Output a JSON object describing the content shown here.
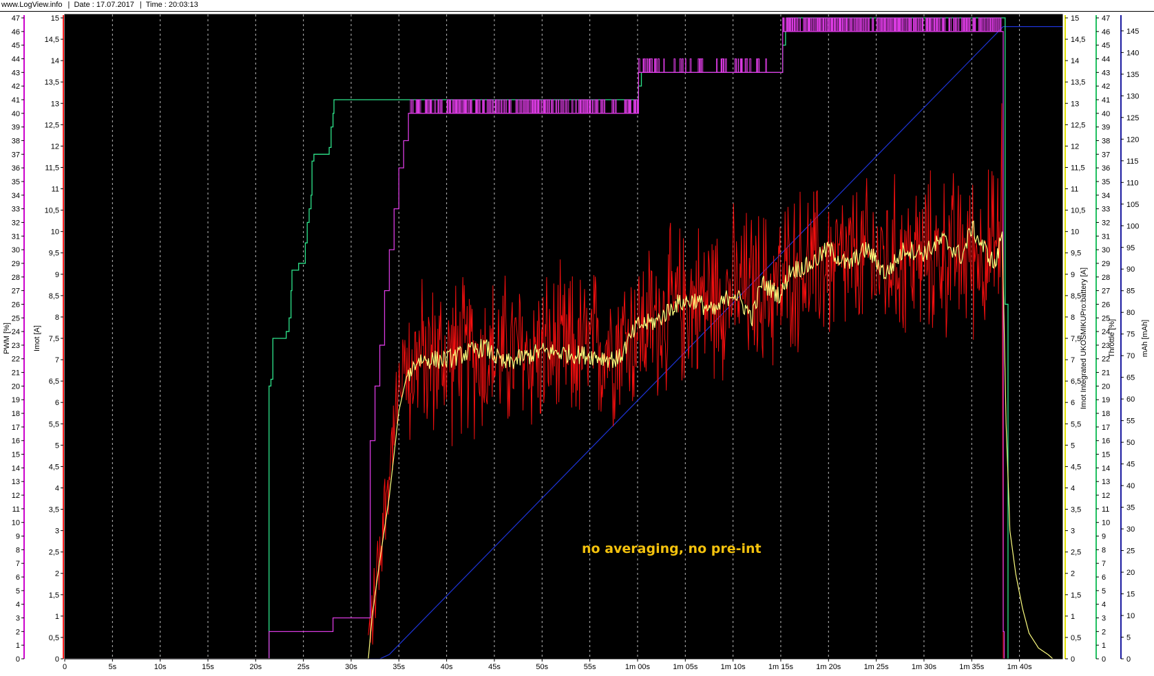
{
  "header": {
    "site": "www.LogView.info",
    "date": "Date : 17.07.2017",
    "time": "Time : 20:03:13"
  },
  "chart_data": {
    "type": "line",
    "annotation": "no averaging, no pre-int",
    "background": "#000000",
    "grid": "vertical dashed",
    "x_axis": {
      "unit": "s",
      "range": [
        0,
        104.5
      ],
      "ticks": [
        {
          "v": 0,
          "label": "0"
        },
        {
          "v": 5,
          "label": "5s"
        },
        {
          "v": 10,
          "label": "10s"
        },
        {
          "v": 15,
          "label": "15s"
        },
        {
          "v": 20,
          "label": "20s"
        },
        {
          "v": 25,
          "label": "25s"
        },
        {
          "v": 30,
          "label": "30s"
        },
        {
          "v": 35,
          "label": "35s"
        },
        {
          "v": 40,
          "label": "40s"
        },
        {
          "v": 45,
          "label": "45s"
        },
        {
          "v": 50,
          "label": "50s"
        },
        {
          "v": 55,
          "label": "55s"
        },
        {
          "v": 60,
          "label": "1m 00s"
        },
        {
          "v": 65,
          "label": "1m 05s"
        },
        {
          "v": 70,
          "label": "1m 10s"
        },
        {
          "v": 75,
          "label": "1m 15s"
        },
        {
          "v": 80,
          "label": "1m 20s"
        },
        {
          "v": 85,
          "label": "1m 25s"
        },
        {
          "v": 90,
          "label": "1m 30s"
        },
        {
          "v": 95,
          "label": "1m 35s"
        },
        {
          "v": 100,
          "label": "1m 40s"
        }
      ]
    },
    "axes": [
      {
        "id": "pwm",
        "title": "PWM [%]",
        "side": "left",
        "color": "#cc00cc",
        "min": 0,
        "max": 47,
        "step": 1,
        "decimal_comma": false
      },
      {
        "id": "imot",
        "title": "Imot [A]",
        "side": "left",
        "color": "#ff2020",
        "min": 0,
        "max": 15,
        "step": 0.5,
        "decimal_comma": true
      },
      {
        "id": "imot_int",
        "title": "Imot Integrated UKOSMIKUPro:battery [A]",
        "side": "right",
        "color": "#e0e000",
        "min": 0,
        "max": 15,
        "step": 0.5,
        "decimal_comma": true
      },
      {
        "id": "throttle",
        "title": "Throttle [%]",
        "side": "right",
        "color": "#20c060",
        "min": 0,
        "max": 47,
        "step": 1,
        "decimal_comma": false
      },
      {
        "id": "mah",
        "title": "mAh [mAh]",
        "side": "right",
        "color": "#1a1aa0",
        "min": 0,
        "max": 148,
        "step": 5,
        "decimal_comma": false
      }
    ],
    "series": [
      {
        "id": "throttle",
        "axis": "throttle",
        "color": "#2ee68c",
        "style": "step",
        "points": [
          [
            0,
            0
          ],
          [
            21.3,
            0
          ],
          [
            21.4,
            20
          ],
          [
            21.6,
            20.5
          ],
          [
            21.8,
            23.5
          ],
          [
            22.8,
            23.5
          ],
          [
            23.2,
            24
          ],
          [
            23.5,
            25
          ],
          [
            23.7,
            27
          ],
          [
            23.8,
            28.5
          ],
          [
            24.5,
            29
          ],
          [
            25.1,
            29
          ],
          [
            25.2,
            30.5
          ],
          [
            25.4,
            32
          ],
          [
            25.6,
            33
          ],
          [
            25.8,
            34
          ],
          [
            25.9,
            36.5
          ],
          [
            26.1,
            37
          ],
          [
            27.6,
            37
          ],
          [
            27.7,
            37.5
          ],
          [
            27.9,
            39
          ],
          [
            28.1,
            40
          ],
          [
            28.2,
            41
          ],
          [
            60.0,
            41
          ],
          [
            60.1,
            42
          ],
          [
            60.4,
            43
          ],
          [
            75.1,
            43
          ],
          [
            75.2,
            45
          ],
          [
            75.5,
            46
          ],
          [
            75.7,
            47
          ],
          [
            98.2,
            47
          ],
          [
            98.5,
            26
          ],
          [
            98.8,
            0
          ]
        ]
      },
      {
        "id": "pwm",
        "axis": "pwm",
        "color": "#d93ae0",
        "style": "step",
        "noise": "to-upper-level",
        "points": [
          [
            0,
            0
          ],
          [
            21.3,
            0
          ],
          [
            21.4,
            2
          ],
          [
            28.0,
            2
          ],
          [
            28.1,
            3
          ],
          [
            31.6,
            3
          ],
          [
            32.0,
            16
          ],
          [
            32.5,
            20
          ],
          [
            33.0,
            23
          ],
          [
            33.5,
            27
          ],
          [
            34.0,
            30
          ],
          [
            34.5,
            33
          ],
          [
            35.0,
            36
          ],
          [
            35.5,
            38
          ],
          [
            36.0,
            40
          ],
          [
            36.2,
            40
          ],
          [
            60.0,
            40
          ],
          [
            60.1,
            43
          ],
          [
            75.1,
            43
          ],
          [
            75.2,
            46
          ],
          [
            98.2,
            46
          ],
          [
            98.3,
            2
          ],
          [
            98.4,
            0
          ]
        ],
        "spikes": [
          {
            "from": 36.2,
            "to": 60,
            "level": 41,
            "density": 0.6
          },
          {
            "from": 60.1,
            "to": 75.1,
            "level": 44,
            "density": 0.25
          },
          {
            "from": 75.2,
            "to": 98.2,
            "level": 47,
            "density": 0.85
          }
        ]
      },
      {
        "id": "mah",
        "axis": "mah",
        "color": "#1e34d8",
        "style": "line",
        "points": [
          [
            0,
            0
          ],
          [
            33,
            0
          ],
          [
            34,
            1
          ],
          [
            98.3,
            146
          ],
          [
            104.5,
            146
          ]
        ]
      },
      {
        "id": "imot_raw",
        "axis": "imot",
        "color": "#ff1010",
        "style": "noisy",
        "baseline": [
          [
            31.8,
            0.3
          ],
          [
            32.5,
            1.5
          ],
          [
            33.5,
            3.5
          ],
          [
            34.5,
            5.5
          ],
          [
            35.5,
            6.7
          ],
          [
            37,
            7.0
          ],
          [
            45,
            7.1
          ],
          [
            55,
            7.2
          ],
          [
            60,
            7.7
          ],
          [
            65,
            8.3
          ],
          [
            70,
            8.6
          ],
          [
            75,
            8.7
          ],
          [
            76,
            9.1
          ],
          [
            85,
            9.3
          ],
          [
            95,
            9.5
          ],
          [
            98.1,
            9.6
          ]
        ],
        "amplitude": 1.9,
        "max": 13.2,
        "min": 4.5
      },
      {
        "id": "imot_int",
        "axis": "imot",
        "color": "#ffff80",
        "style": "line",
        "points": [
          [
            0,
            0
          ],
          [
            31.8,
            0
          ],
          [
            32.2,
            1.0
          ],
          [
            33.0,
            2.3
          ],
          [
            34.0,
            3.8
          ],
          [
            35.0,
            5.8
          ],
          [
            35.8,
            6.6
          ],
          [
            37,
            7.0
          ],
          [
            40,
            7.0
          ],
          [
            44,
            7.3
          ],
          [
            46,
            6.9
          ],
          [
            50,
            7.2
          ],
          [
            55,
            7.1
          ],
          [
            58,
            7.0
          ],
          [
            60,
            7.8
          ],
          [
            62,
            7.9
          ],
          [
            64,
            8.3
          ],
          [
            66,
            8.4
          ],
          [
            68,
            8.1
          ],
          [
            70,
            8.6
          ],
          [
            72,
            8.0
          ],
          [
            73,
            8.8
          ],
          [
            75,
            8.5
          ],
          [
            76,
            9.1
          ],
          [
            78,
            9.2
          ],
          [
            80,
            9.6
          ],
          [
            82,
            9.2
          ],
          [
            84,
            9.6
          ],
          [
            86,
            9.0
          ],
          [
            88,
            9.6
          ],
          [
            90,
            9.5
          ],
          [
            92,
            9.8
          ],
          [
            94,
            9.4
          ],
          [
            95,
            10.1
          ],
          [
            96,
            9.7
          ],
          [
            97.5,
            9.2
          ],
          [
            98.2,
            10.0
          ],
          [
            98.6,
            5.5
          ],
          [
            99.0,
            3.0
          ],
          [
            99.6,
            2.0
          ],
          [
            100.3,
            1.2
          ],
          [
            101,
            0.6
          ],
          [
            102,
            0.25
          ],
          [
            103,
            0.1
          ],
          [
            103.5,
            0.0
          ]
        ]
      }
    ]
  }
}
